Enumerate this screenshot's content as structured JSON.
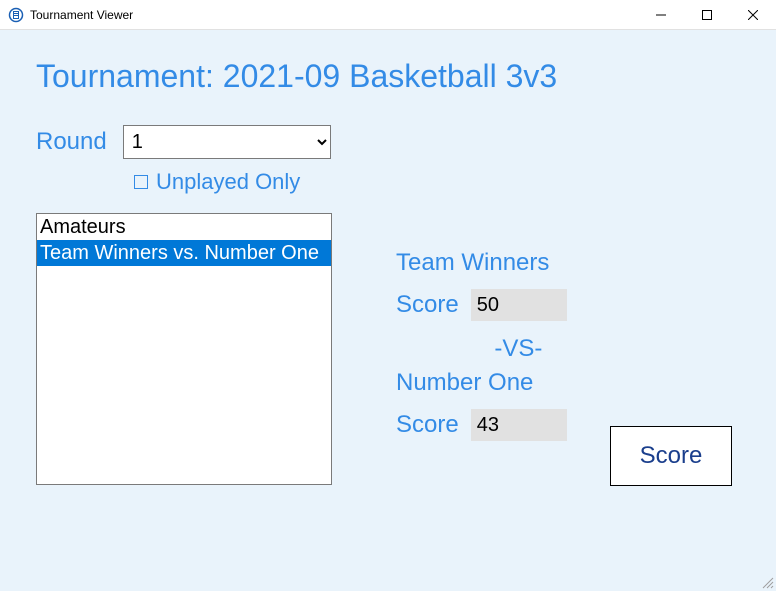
{
  "window": {
    "title": "Tournament Viewer"
  },
  "heading": "Tournament: 2021-09 Basketball 3v3",
  "round": {
    "label": "Round",
    "value": "1"
  },
  "unplayed": {
    "label": "Unplayed Only",
    "checked": false
  },
  "matchups": [
    {
      "label": "Amateurs"
    },
    {
      "label": "Team Winners vs. Number One"
    }
  ],
  "selected_matchup_index": 1,
  "detail": {
    "team1": {
      "name": "Team Winners",
      "score_label": "Score",
      "score": "50"
    },
    "vs": "-VS-",
    "team2": {
      "name": "Number One",
      "score_label": "Score",
      "score": "43"
    }
  },
  "buttons": {
    "score": "Score"
  }
}
